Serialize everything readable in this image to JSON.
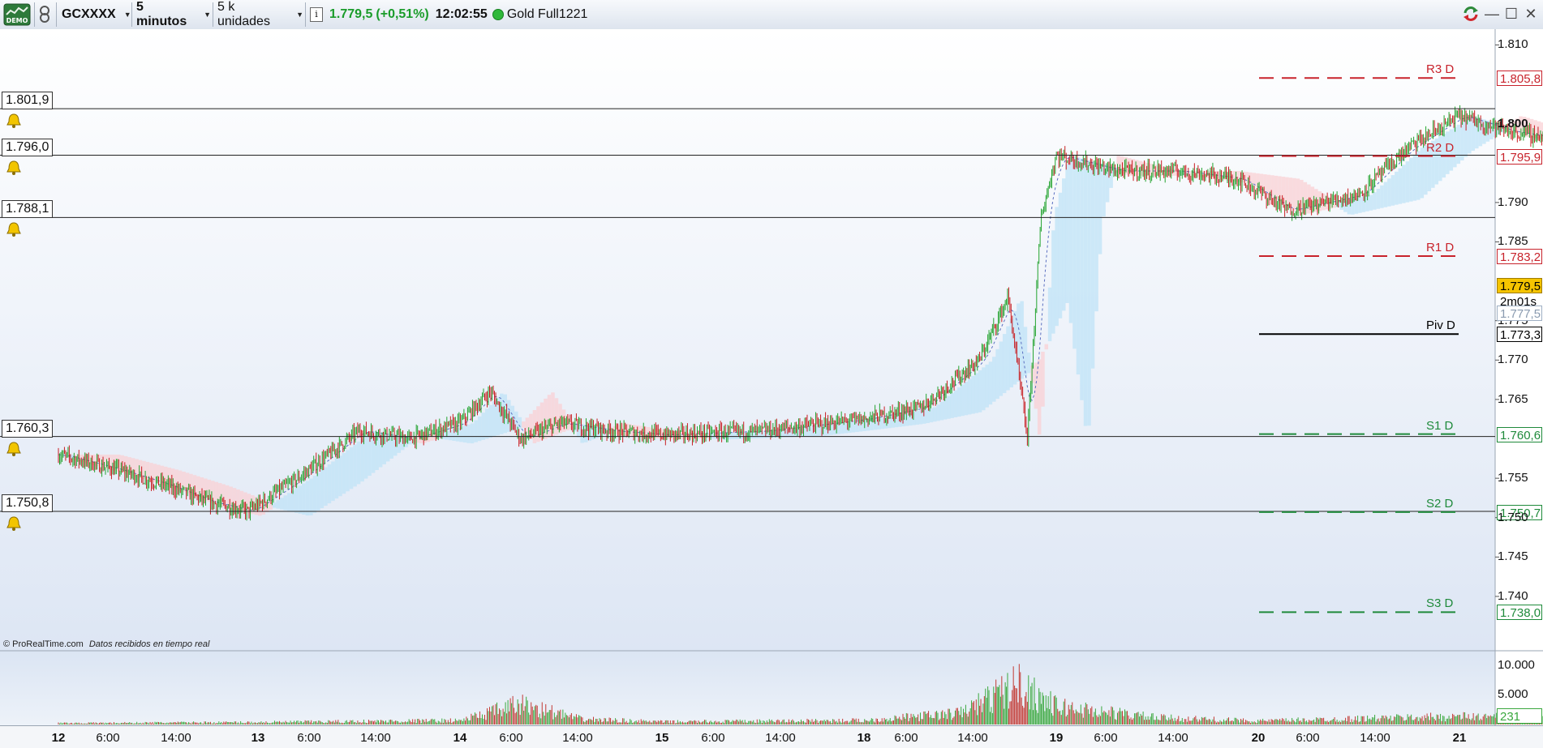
{
  "toolbar": {
    "demo_label": "DEMO",
    "symbol": "GCXXXX",
    "timeframe": "5 minutos",
    "units": "5 k unidades",
    "info_label": "i",
    "last_price": "1.779,5",
    "change": "(+0,51%)",
    "time": "12:02:55",
    "instrument": "Gold Full1221",
    "colors": {
      "up": "#1a9c2a",
      "status_dot": "#2fb83a"
    }
  },
  "alert_levels": [
    {
      "value": "1.801,9",
      "price": 1801.9
    },
    {
      "value": "1.796,0",
      "price": 1796.0
    },
    {
      "value": "1.788,1",
      "price": 1788.1
    },
    {
      "value": "1.760,3",
      "price": 1760.3
    },
    {
      "value": "1.750,8",
      "price": 1750.8
    }
  ],
  "pivots": [
    {
      "label": "R3 D",
      "value": "1.805,8",
      "price": 1805.8,
      "color": "#c8232c"
    },
    {
      "label": "R2 D",
      "value": "1.795,9",
      "price": 1795.9,
      "color": "#c8232c"
    },
    {
      "label": "R1 D",
      "value": "1.783,2",
      "price": 1783.2,
      "color": "#c8232c"
    },
    {
      "label": "Piv D",
      "value": "1.773,3",
      "price": 1773.3,
      "color": "#000000"
    },
    {
      "label": "S1 D",
      "value": "1.760,6",
      "price": 1760.6,
      "color": "#1f8a3b"
    },
    {
      "label": "S2 D",
      "value": "1.750,7",
      "price": 1750.7,
      "color": "#1f8a3b"
    },
    {
      "label": "S3 D",
      "value": "1.738,0",
      "price": 1738.0,
      "color": "#1f8a3b"
    }
  ],
  "price_axis": {
    "ticks": [
      "1.810",
      "1.800",
      "1.790",
      "1.785",
      "1.775",
      "1.770",
      "1.765",
      "1.755",
      "1.750",
      "1.745",
      "1.740"
    ],
    "current_price": "1.779,5",
    "countdown": "2m01s",
    "ichimoku_value": "1.777,5"
  },
  "volume_axis": {
    "ticks": [
      "10.000",
      "5.000"
    ],
    "current_volume": "231"
  },
  "x_axis": {
    "labels": [
      "12",
      "6:00",
      "14:00",
      "13",
      "6:00",
      "14:00",
      "14",
      "6:00",
      "14:00",
      "15",
      "6:00",
      "14:00",
      "18",
      "6:00",
      "14:00",
      "19",
      "6:00",
      "14:00",
      "20",
      "6:00",
      "14:00",
      "21"
    ],
    "day_labels": [
      "12",
      "13",
      "14",
      "15",
      "18",
      "19",
      "20",
      "21"
    ]
  },
  "credit": {
    "source": "© ProRealTime.com",
    "note": "Datos recibidos en tiempo real"
  },
  "chart_data": {
    "type": "candlestick",
    "ylim": [
      1733,
      1812
    ],
    "price_path": [
      [
        0,
        1758
      ],
      [
        0.3,
        1756
      ],
      [
        0.55,
        1754
      ],
      [
        0.75,
        1752
      ],
      [
        0.95,
        1750.8
      ],
      [
        1.2,
        1755
      ],
      [
        1.5,
        1761
      ],
      [
        1.75,
        1760
      ],
      [
        2,
        1762
      ],
      [
        2.15,
        1766
      ],
      [
        2.3,
        1760
      ],
      [
        2.5,
        1762
      ],
      [
        2.75,
        1761
      ],
      [
        3,
        1760.5
      ],
      [
        3.5,
        1761
      ],
      [
        4,
        1762.5
      ],
      [
        4.3,
        1764
      ],
      [
        4.6,
        1770
      ],
      [
        4.75,
        1778
      ],
      [
        4.85,
        1760
      ],
      [
        4.92,
        1788
      ],
      [
        5,
        1796
      ],
      [
        5.3,
        1794
      ],
      [
        5.6,
        1794
      ],
      [
        5.9,
        1793
      ],
      [
        6.15,
        1789
      ],
      [
        6.5,
        1791
      ],
      [
        6.75,
        1797
      ],
      [
        7,
        1801
      ],
      [
        7.25,
        1799
      ],
      [
        7.5,
        1798
      ],
      [
        7.8,
        1800
      ],
      [
        8,
        1798
      ],
      [
        8.3,
        1797
      ],
      [
        8.6,
        1796
      ],
      [
        8.9,
        1795.5
      ],
      [
        9.1,
        1792
      ],
      [
        9.3,
        1787
      ],
      [
        9.5,
        1782
      ],
      [
        9.7,
        1776
      ],
      [
        9.8,
        1767
      ],
      [
        9.9,
        1774
      ],
      [
        10.05,
        1769
      ],
      [
        10.3,
        1768
      ],
      [
        10.6,
        1769
      ],
      [
        10.8,
        1771
      ],
      [
        11,
        1771
      ],
      [
        11.2,
        1769
      ],
      [
        11.4,
        1767
      ],
      [
        11.6,
        1764
      ],
      [
        11.8,
        1762
      ],
      [
        12,
        1763
      ],
      [
        12.15,
        1769
      ],
      [
        12.25,
        1771
      ],
      [
        12.4,
        1768
      ],
      [
        12.6,
        1767
      ],
      [
        12.9,
        1766
      ],
      [
        13.2,
        1765
      ],
      [
        13.4,
        1770
      ],
      [
        13.6,
        1776
      ],
      [
        13.8,
        1781
      ],
      [
        14,
        1783
      ],
      [
        14.2,
        1779
      ],
      [
        14.4,
        1784
      ],
      [
        14.55,
        1776
      ],
      [
        14.7,
        1771
      ],
      [
        14.9,
        1769
      ],
      [
        15.1,
        1770
      ],
      [
        15.3,
        1769.5
      ],
      [
        15.5,
        1769
      ],
      [
        15.65,
        1769
      ],
      [
        15.8,
        1773
      ],
      [
        16,
        1773.5
      ],
      [
        16.2,
        1775
      ],
      [
        16.4,
        1777
      ],
      [
        16.6,
        1779
      ],
      [
        16.75,
        1779.5
      ]
    ],
    "volume_profile": [
      [
        0,
        300
      ],
      [
        1,
        500
      ],
      [
        2,
        900
      ],
      [
        2.3,
        4500
      ],
      [
        2.6,
        1200
      ],
      [
        3,
        600
      ],
      [
        4,
        900
      ],
      [
        4.5,
        2500
      ],
      [
        4.8,
        9000
      ],
      [
        5,
        4000
      ],
      [
        5.5,
        1500
      ],
      [
        6,
        800
      ],
      [
        7,
        1800
      ],
      [
        8,
        1000
      ],
      [
        8.8,
        800
      ],
      [
        9.4,
        2200
      ],
      [
        9.7,
        6000
      ],
      [
        10,
        1500
      ],
      [
        11,
        800
      ],
      [
        11.4,
        1400
      ],
      [
        12,
        2600
      ],
      [
        12.4,
        1600
      ],
      [
        13,
        900
      ],
      [
        13.6,
        1200
      ],
      [
        14.3,
        2800
      ],
      [
        15,
        1000
      ],
      [
        15.5,
        500
      ],
      [
        16,
        900
      ],
      [
        16.75,
        231
      ]
    ]
  }
}
